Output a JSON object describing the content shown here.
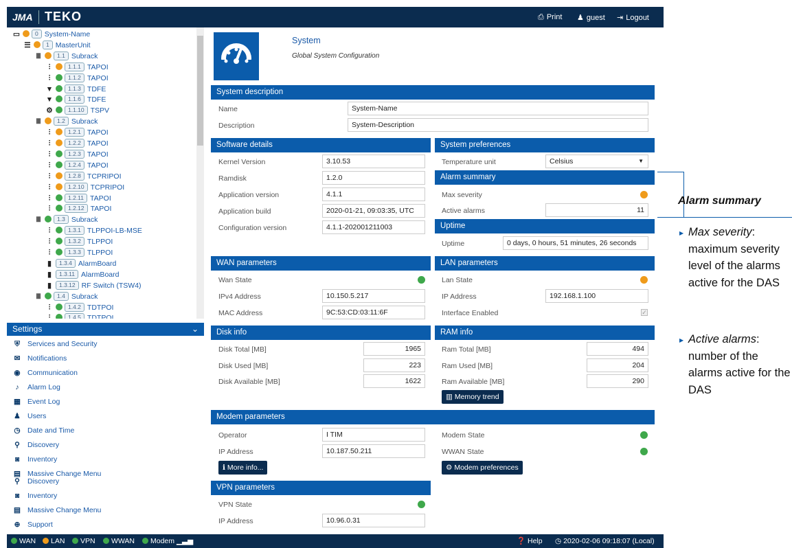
{
  "topbar": {
    "logo_left": "JMA",
    "logo_right": "TEKO",
    "print": "Print",
    "user": "guest",
    "logout": "Logout"
  },
  "tree": [
    {
      "icon": "monitor-icon",
      "glyph": "▭",
      "status": "o",
      "badge": "0",
      "label": "System-Name"
    },
    {
      "icon": "menu-icon",
      "glyph": "☰",
      "status": "o",
      "badge": "1",
      "label": "MasterUnit"
    },
    {
      "icon": "rack-icon",
      "glyph": "Ⅲ",
      "status": "o",
      "badge": "1.1",
      "label": "Subrack"
    },
    {
      "icon": "sliders-icon",
      "glyph": "⫶",
      "status": "o",
      "badge": "1.1.1",
      "label": "TAPOI"
    },
    {
      "icon": "sliders-icon",
      "glyph": "⫶",
      "status": "g",
      "badge": "1.1.2",
      "label": "TAPOI"
    },
    {
      "icon": "filter-icon",
      "glyph": "▼",
      "status": "g",
      "badge": "1.1.3",
      "label": "TDFE"
    },
    {
      "icon": "filter-icon",
      "glyph": "▼",
      "status": "g",
      "badge": "1.1.6",
      "label": "TDFE"
    },
    {
      "icon": "gears-icon",
      "glyph": "⚙",
      "status": "g",
      "badge": "1.1.10",
      "label": "TSPV"
    },
    {
      "icon": "rack-icon",
      "glyph": "Ⅲ",
      "status": "o",
      "badge": "1.2",
      "label": "Subrack"
    },
    {
      "icon": "sliders-icon",
      "glyph": "⫶",
      "status": "o",
      "badge": "1.2.1",
      "label": "TAPOI"
    },
    {
      "icon": "sliders-icon",
      "glyph": "⫶",
      "status": "o",
      "badge": "1.2.2",
      "label": "TAPOI"
    },
    {
      "icon": "sliders-icon",
      "glyph": "⫶",
      "status": "g",
      "badge": "1.2.3",
      "label": "TAPOI"
    },
    {
      "icon": "sliders-icon",
      "glyph": "⫶",
      "status": "g",
      "badge": "1.2.4",
      "label": "TAPOI"
    },
    {
      "icon": "sliders-icon",
      "glyph": "⫶",
      "status": "o",
      "badge": "1.2.8",
      "label": "TCPRIPOI"
    },
    {
      "icon": "sliders-icon",
      "glyph": "⫶",
      "status": "o",
      "badge": "1.2.10",
      "label": "TCPRIPOI"
    },
    {
      "icon": "sliders-icon",
      "glyph": "⫶",
      "status": "g",
      "badge": "1.2.11",
      "label": "TAPOI"
    },
    {
      "icon": "sliders-icon",
      "glyph": "⫶",
      "status": "g",
      "badge": "1.2.12",
      "label": "TAPOI"
    },
    {
      "icon": "rack-icon",
      "glyph": "Ⅲ",
      "status": "g",
      "badge": "1.3",
      "label": "Subrack"
    },
    {
      "icon": "sliders-icon",
      "glyph": "⫶",
      "status": "g",
      "badge": "1.3.1",
      "label": "TLPPOI-LB-MSE"
    },
    {
      "icon": "sliders-icon",
      "glyph": "⫶",
      "status": "g",
      "badge": "1.3.2",
      "label": "TLPPOI"
    },
    {
      "icon": "sliders-icon",
      "glyph": "⫶",
      "status": "g",
      "badge": "1.3.3",
      "label": "TLPPOI"
    },
    {
      "icon": "board-icon",
      "glyph": "▮",
      "status": "",
      "badge": "1.3.4",
      "label": "AlarmBoard"
    },
    {
      "icon": "board-icon",
      "glyph": "▮",
      "status": "",
      "badge": "1.3.11",
      "label": "AlarmBoard"
    },
    {
      "icon": "board-icon",
      "glyph": "▮",
      "status": "",
      "badge": "1.3.12",
      "label": "RF Switch (TSW4)"
    },
    {
      "icon": "rack-icon",
      "glyph": "Ⅲ",
      "status": "g",
      "badge": "1.4",
      "label": "Subrack"
    },
    {
      "icon": "sliders-icon",
      "glyph": "⫶",
      "status": "g",
      "badge": "1.4.2",
      "label": "TDTPOI"
    },
    {
      "icon": "sliders-icon",
      "glyph": "⫶",
      "status": "g",
      "badge": "1.4.5",
      "label": "TDTPOI"
    }
  ],
  "settings": {
    "title": "Settings",
    "items": [
      {
        "icon": "shield-icon",
        "glyph": "⛨",
        "label": "Services and Security"
      },
      {
        "icon": "envelope-icon",
        "glyph": "✉",
        "label": "Notifications"
      },
      {
        "icon": "globe-icon",
        "glyph": "◉",
        "label": "Communication"
      },
      {
        "icon": "bell-icon",
        "glyph": "♪",
        "label": "Alarm Log"
      },
      {
        "icon": "calendar-icon",
        "glyph": "▦",
        "label": "Event Log"
      },
      {
        "icon": "users-icon",
        "glyph": "♟",
        "label": "Users"
      },
      {
        "icon": "clock-icon",
        "glyph": "◷",
        "label": "Date and Time"
      },
      {
        "icon": "search-icon",
        "glyph": "⚲",
        "label": "Discovery"
      },
      {
        "icon": "camera-icon",
        "glyph": "◙",
        "label": "Inventory"
      },
      {
        "icon": "table-icon",
        "glyph": "▤",
        "label": "Massive Change Menu"
      },
      {
        "icon": "search-icon",
        "glyph": "⚲",
        "label": "Discovery"
      },
      {
        "icon": "camera-icon",
        "glyph": "◙",
        "label": "Inventory"
      },
      {
        "icon": "table-icon",
        "glyph": "▤",
        "label": "Massive Change Menu"
      },
      {
        "icon": "support-icon",
        "glyph": "⊕",
        "label": "Support"
      }
    ]
  },
  "main": {
    "title": "System",
    "subtitle": "Global System Configuration",
    "system_description": {
      "title": "System description",
      "name_label": "Name",
      "name_value": "System-Name",
      "desc_label": "Description",
      "desc_value": "System-Description"
    },
    "software": {
      "title": "Software details",
      "rows": [
        {
          "label": "Kernel Version",
          "value": "3.10.53"
        },
        {
          "label": "Ramdisk",
          "value": "1.2.0"
        },
        {
          "label": "Application version",
          "value": "4.1.1"
        },
        {
          "label": "Application build",
          "value": "2020-01-21, 09:03:35, UTC"
        },
        {
          "label": "Configuration version",
          "value": "4.1.1-202001211003"
        }
      ]
    },
    "preferences": {
      "title": "System preferences",
      "temp_label": "Temperature unit",
      "temp_value": "Celsius"
    },
    "alarm_summary": {
      "title": "Alarm summary",
      "max_label": "Max severity",
      "active_label": "Active alarms",
      "active_value": "11",
      "max_color": "#ef9b1b"
    },
    "uptime": {
      "title": "Uptime",
      "label": "Uptime",
      "value": "0 days, 0 hours, 51 minutes, 26 seconds"
    },
    "wan": {
      "title": "WAN parameters",
      "state_label": "Wan State",
      "ipv4_label": "IPv4 Address",
      "ipv4_value": "10.150.5.217",
      "mac_label": "MAC Address",
      "mac_value": "9C:53:CD:03:11:6F"
    },
    "lan": {
      "title": "LAN parameters",
      "state_label": "Lan State",
      "ip_label": "IP Address",
      "ip_value": "192.168.1.100",
      "iface_label": "Interface Enabled"
    },
    "disk": {
      "title": "Disk info",
      "total_label": "Disk Total [MB]",
      "total": "1965",
      "used_label": "Disk Used [MB]",
      "used": "223",
      "avail_label": "Disk Available [MB]",
      "avail": "1622"
    },
    "ram": {
      "title": "RAM info",
      "total_label": "Ram Total [MB]",
      "total": "494",
      "used_label": "Ram Used [MB]",
      "used": "204",
      "avail_label": "Ram Available [MB]",
      "avail": "290",
      "trend_button": "Memory trend"
    },
    "modem": {
      "title": "Modem parameters",
      "operator_label": "Operator",
      "operator_value": "I TIM",
      "ip_label": "IP Address",
      "ip_value": "10.187.50.211",
      "modem_state_label": "Modem State",
      "wwan_state_label": "WWAN State",
      "more_button": "More info...",
      "prefs_button": "Modem preferences"
    },
    "vpn": {
      "title": "VPN parameters",
      "state_label": "VPN State",
      "ip_label": "IP Address",
      "ip_value": "10.96.0.31"
    }
  },
  "statusbar": {
    "wan": "WAN",
    "lan": "LAN",
    "vpn": "VPN",
    "wwan": "WWAN",
    "modem": "Modem",
    "help": "Help",
    "datetime": "2020-02-06 09:18:07 (Local)"
  },
  "annotation": {
    "title": "Alarm summary",
    "item1_term": "Max severity",
    "item1_desc": ": maximum severity level of the alarms active for the DAS",
    "item2_term": "Active alarms",
    "item2_desc": ": number of the alarms active for the DAS"
  },
  "colors": {
    "navy": "#0b2c4f",
    "blue": "#0b5cab",
    "orange": "#ef9b1b",
    "green": "#3fa84b"
  }
}
